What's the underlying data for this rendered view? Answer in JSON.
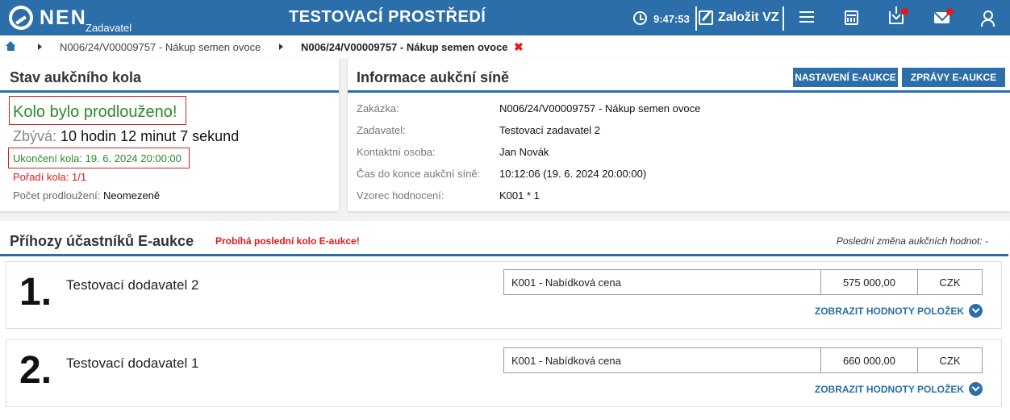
{
  "header": {
    "logo_text": "NEN",
    "logo_subtext": "Zadavatel",
    "environment_title": "TESTOVACÍ PROSTŘEDÍ",
    "clock_time": "9:47:53",
    "create_label": "Založit VZ"
  },
  "breadcrumb": {
    "items": [
      "N006/24/V00009757 - Nákup semen ovoce",
      "N006/24/V00009757 - Nákup semen ovoce"
    ]
  },
  "round_status": {
    "title": "Stav aukčního kola",
    "extended_message": "Kolo bylo prodlouženo!",
    "remaining_label": "Zbývá:",
    "remaining_value": "10 hodin 12 minut 7 sekund",
    "end_text": "Ukončení kola: 19. 6. 2024 20:00:00",
    "order_text": "Pořadí kola: 1/1",
    "extensions_label": "Počet prodloužení:",
    "extensions_value": "Neomezeně"
  },
  "auction_info": {
    "title": "Informace aukční síně",
    "settings_button": "NASTAVENÍ E-AUKCE",
    "messages_button": "ZPRÁVY E-AUKCE",
    "rows": [
      {
        "label": "Zakázka:",
        "value": "N006/24/V00009757 - Nákup semen ovoce"
      },
      {
        "label": "Zadavatel:",
        "value": "Testovací zadavatel 2"
      },
      {
        "label": "Kontaktní osoba:",
        "value": "Jan Novák"
      },
      {
        "label": "Čas do konce aukční síně:",
        "value": "10:12:06 (19. 6. 2024 20:00:00)"
      },
      {
        "label": "Vzorec hodnocení:",
        "value": "K001 * 1"
      }
    ]
  },
  "bids": {
    "title": "Příhozy účastníků E-aukce",
    "final_round_notice": "Probíhá poslední kolo E-aukce!",
    "last_change": "Poslední změna aukčních hodnot: -",
    "show_items_label": "ZOBRAZIT HODNOTY POLOŽEK",
    "entries": [
      {
        "rank": "1.",
        "name": "Testovací dodavatel 2",
        "criterion": "K001 - Nabídková cena",
        "amount": "575 000,00",
        "currency": "CZK"
      },
      {
        "rank": "2.",
        "name": "Testovací dodavatel 1",
        "criterion": "K001 - Nabídková cena",
        "amount": "660 000,00",
        "currency": "CZK"
      }
    ]
  },
  "colors": {
    "brand_blue": "#2b6eaa",
    "success_green": "#2a8a2a",
    "alert_red": "#e11a1a"
  }
}
